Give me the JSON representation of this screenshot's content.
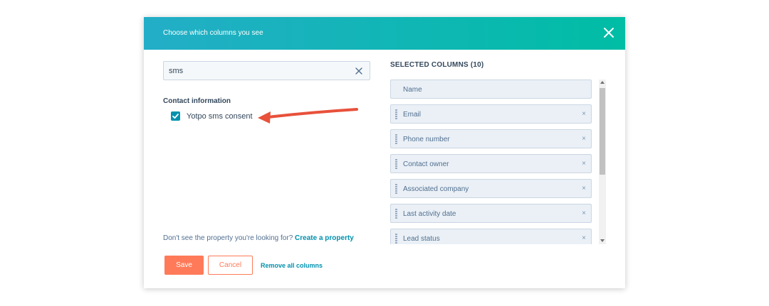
{
  "modal": {
    "title": "Choose which columns you see",
    "close_icon": "close-icon"
  },
  "search": {
    "value": "sms",
    "clear_icon": "clear-icon"
  },
  "results": {
    "group_label": "Contact information",
    "options": [
      {
        "label": "Yotpo sms consent",
        "checked": true
      }
    ]
  },
  "hint": {
    "text": "Don't see the property you're looking for?",
    "link": "Create a property"
  },
  "selected": {
    "title": "SELECTED COLUMNS (10)",
    "columns": [
      {
        "label": "Name",
        "removable": false
      },
      {
        "label": "Email",
        "removable": true
      },
      {
        "label": "Phone number",
        "removable": true
      },
      {
        "label": "Contact owner",
        "removable": true
      },
      {
        "label": "Associated company",
        "removable": true
      },
      {
        "label": "Last activity date",
        "removable": true
      },
      {
        "label": "Lead status",
        "removable": true
      }
    ],
    "remove_glyph": "×"
  },
  "footer": {
    "save_label": "Save",
    "cancel_label": "Cancel",
    "remove_all_label": "Remove all columns"
  },
  "colors": {
    "header_gradient_start": "#23aec7",
    "header_gradient_end": "#00bda5",
    "accent_orange": "#ff7a59",
    "link_blue": "#0091ae",
    "annotation_red": "#e8513b"
  }
}
